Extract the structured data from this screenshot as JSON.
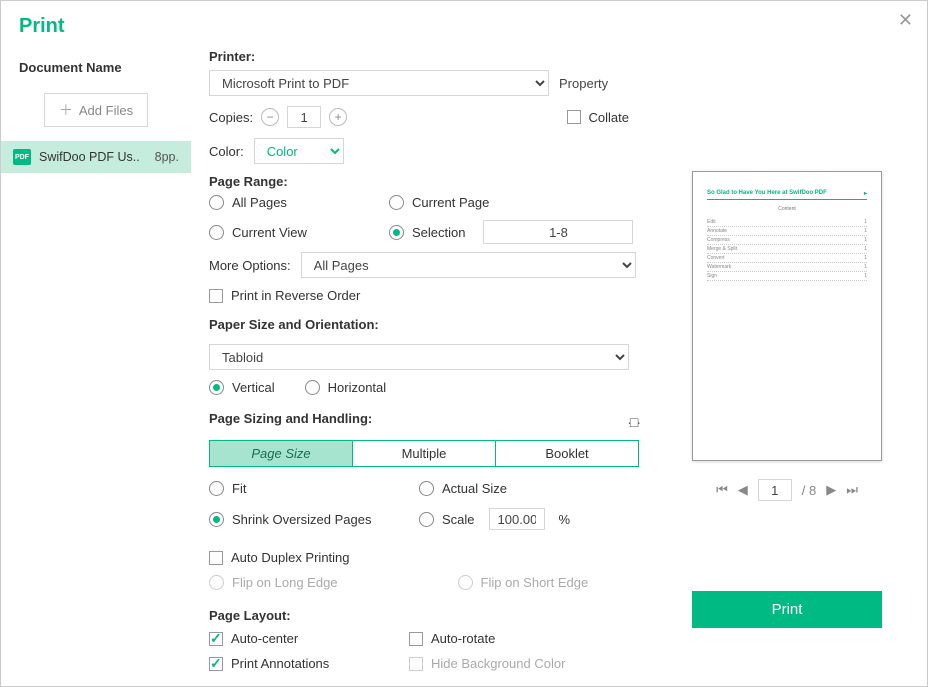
{
  "dialog": {
    "title": "Print"
  },
  "sidebar": {
    "section_label": "Document Name",
    "add_files_label": "Add Files",
    "file": {
      "name": "SwifDoo PDF Us..",
      "pages": "8pp."
    }
  },
  "printer": {
    "label": "Printer:",
    "selected": "Microsoft Print to PDF",
    "property_label": "Property"
  },
  "copies": {
    "label": "Copies:",
    "value": "1"
  },
  "collate": {
    "label": "Collate",
    "checked": false
  },
  "color": {
    "label": "Color:",
    "value": "Color"
  },
  "range": {
    "heading": "Page Range:",
    "all": "All Pages",
    "current_page": "Current Page",
    "current_view": "Current View",
    "selection": "Selection",
    "selection_value": "1-8",
    "selected": "selection"
  },
  "more_options": {
    "label": "More Options:",
    "value": "All Pages"
  },
  "reverse": {
    "label": "Print in Reverse Order",
    "checked": false
  },
  "paper": {
    "heading": "Paper Size and Orientation:",
    "size": "Tabloid",
    "vertical": "Vertical",
    "horizontal": "Horizontal",
    "orientation": "vertical"
  },
  "sizing": {
    "heading": "Page Sizing and Handling:",
    "tabs": {
      "size": "Page Size",
      "multiple": "Multiple",
      "booklet": "Booklet"
    },
    "active_tab": "size",
    "fit": "Fit",
    "actual": "Actual Size",
    "shrink": "Shrink Oversized Pages",
    "scale": "Scale",
    "scale_value": "100.00",
    "scale_unit": "%",
    "selected": "shrink"
  },
  "duplex": {
    "auto": "Auto Duplex Printing",
    "auto_checked": false,
    "flip_long": "Flip on Long Edge",
    "flip_short": "Flip on Short Edge"
  },
  "layout": {
    "heading": "Page Layout:",
    "auto_center": "Auto-center",
    "auto_center_checked": true,
    "auto_rotate": "Auto-rotate",
    "auto_rotate_checked": false,
    "print_annotations": "Print Annotations",
    "print_annotations_checked": true,
    "hide_bg": "Hide Background Color",
    "hide_bg_checked": false
  },
  "preview": {
    "title": "So Glad to Have You Here at SwifDoo PDF",
    "subtitle": "Content",
    "toc": [
      "Edit",
      "Annotate",
      "Compress",
      "Merge & Split",
      "Convert",
      "Watermark",
      "Sign"
    ],
    "page_current": "1",
    "page_total": "/ 8"
  },
  "actions": {
    "print": "Print"
  }
}
